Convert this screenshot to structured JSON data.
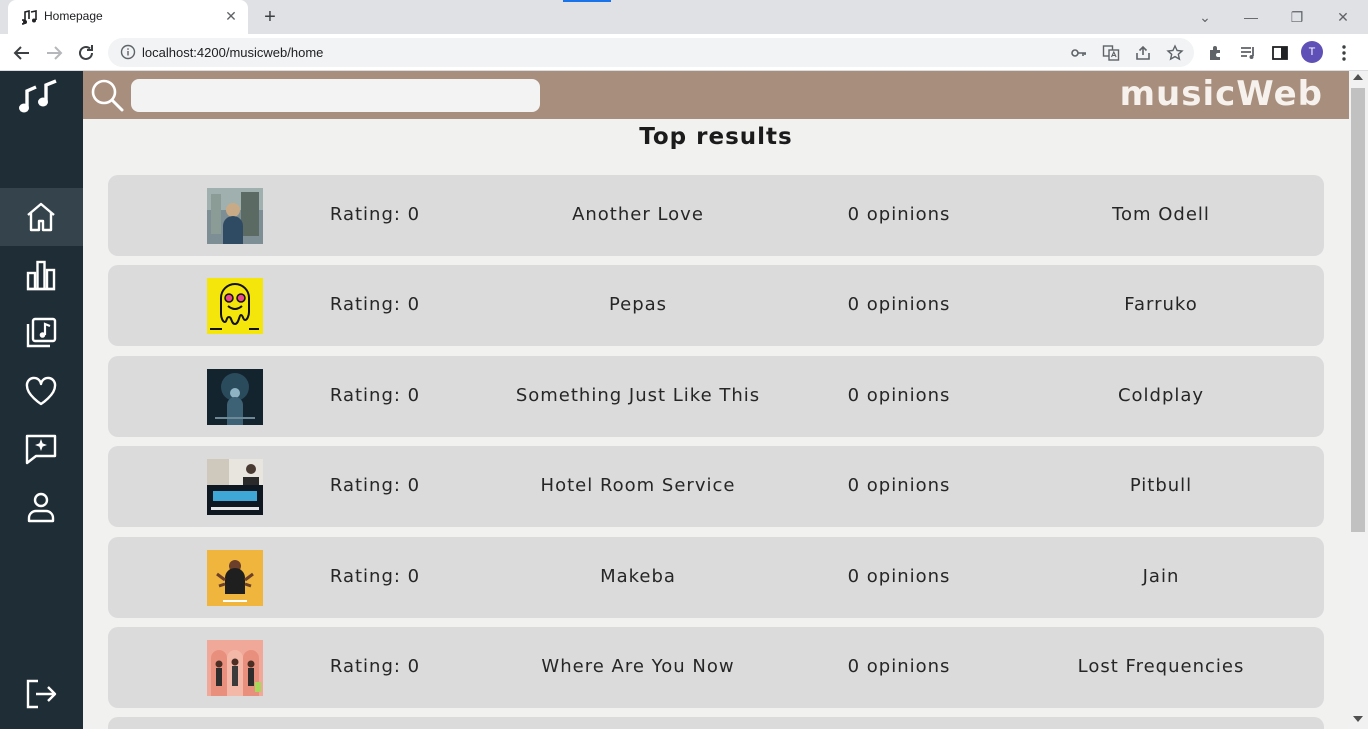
{
  "browser": {
    "tab_title": "Homepage",
    "tab_close": "✕",
    "new_tab": "+",
    "url": "localhost:4200/musicweb/home",
    "profile_initial": "T",
    "window_controls": {
      "dropdown": "⌄",
      "minimize": "—",
      "restore": "❐",
      "close": "✕"
    }
  },
  "header": {
    "brand": "musicWeb",
    "search_value": "",
    "search_placeholder": ""
  },
  "sidebar": {
    "items": [
      {
        "id": "home",
        "icon": "home-icon",
        "active": true
      },
      {
        "id": "charts",
        "icon": "bar-chart-icon",
        "active": false
      },
      {
        "id": "library",
        "icon": "music-library-icon",
        "active": false
      },
      {
        "id": "favorites",
        "icon": "heart-icon",
        "active": false
      },
      {
        "id": "reviews",
        "icon": "message-sparkle-icon",
        "active": false
      },
      {
        "id": "profile",
        "icon": "user-icon",
        "active": false
      }
    ],
    "logout_icon": "logout-icon"
  },
  "main": {
    "title": "Top results",
    "results": [
      {
        "rating": "Rating: 0",
        "title": "Another Love",
        "opinions": "0 opinions",
        "artist": "Tom Odell"
      },
      {
        "rating": "Rating: 0",
        "title": "Pepas",
        "opinions": "0 opinions",
        "artist": "Farruko"
      },
      {
        "rating": "Rating: 0",
        "title": "Something Just Like This",
        "opinions": "0 opinions",
        "artist": "Coldplay"
      },
      {
        "rating": "Rating: 0",
        "title": "Hotel Room Service",
        "opinions": "0 opinions",
        "artist": "Pitbull"
      },
      {
        "rating": "Rating: 0",
        "title": "Makeba",
        "opinions": "0 opinions",
        "artist": "Jain"
      },
      {
        "rating": "Rating: 0",
        "title": "Where Are You Now",
        "opinions": "0 opinions",
        "artist": "Lost Frequencies"
      }
    ]
  },
  "colors": {
    "sidebar_bg": "#1f2d36",
    "sidebar_active": "#34434c",
    "header_bg": "#a88f7d",
    "row_bg": "#dadbda",
    "page_bg": "#f1f1f0"
  }
}
